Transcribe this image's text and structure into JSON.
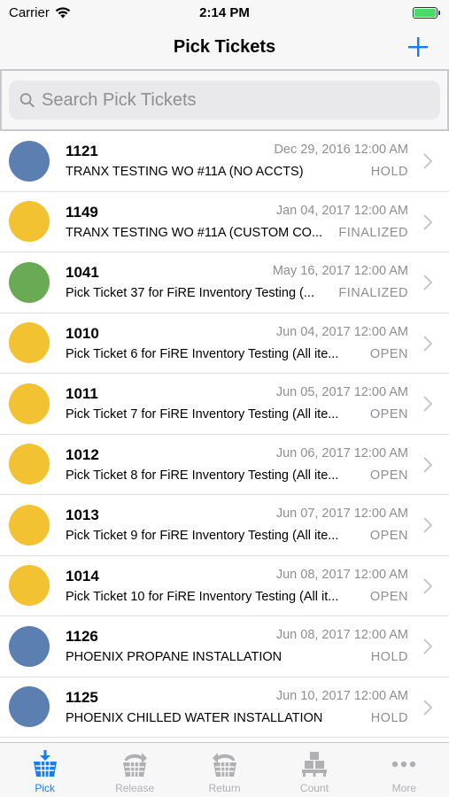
{
  "status_bar": {
    "carrier": "Carrier",
    "time": "2:14 PM"
  },
  "nav": {
    "title": "Pick Tickets"
  },
  "search": {
    "placeholder": "Search Pick Tickets"
  },
  "colors": {
    "accent": "#1a7cf3",
    "hold": "#5b7fb0",
    "open": "#f2c232",
    "finalized_green": "#6aaa55"
  },
  "tickets": [
    {
      "id": "1121",
      "date": "Dec 29, 2016 12:00 AM",
      "description": "TRANX TESTING WO #11A (NO ACCTS)",
      "status": "HOLD",
      "color": "#5b7fb0"
    },
    {
      "id": "1149",
      "date": "Jan 04, 2017 12:00 AM",
      "description": "TRANX TESTING WO #11A (CUSTOM CO...",
      "status": "FINALIZED",
      "color": "#f2c232"
    },
    {
      "id": "1041",
      "date": "May 16, 2017 12:00 AM",
      "description": "Pick Ticket 37 for FiRE Inventory Testing (...",
      "status": "FINALIZED",
      "color": "#6aaa55"
    },
    {
      "id": "1010",
      "date": "Jun 04, 2017 12:00 AM",
      "description": "Pick Ticket 6 for FiRE Inventory Testing (All ite...",
      "status": "OPEN",
      "color": "#f2c232"
    },
    {
      "id": "1011",
      "date": "Jun 05, 2017 12:00 AM",
      "description": "Pick Ticket 7 for FiRE Inventory Testing (All ite...",
      "status": "OPEN",
      "color": "#f2c232"
    },
    {
      "id": "1012",
      "date": "Jun 06, 2017 12:00 AM",
      "description": "Pick Ticket 8 for FiRE Inventory Testing (All ite...",
      "status": "OPEN",
      "color": "#f2c232"
    },
    {
      "id": "1013",
      "date": "Jun 07, 2017 12:00 AM",
      "description": "Pick Ticket 9 for FiRE Inventory Testing (All ite...",
      "status": "OPEN",
      "color": "#f2c232"
    },
    {
      "id": "1014",
      "date": "Jun 08, 2017 12:00 AM",
      "description": "Pick Ticket 10 for FiRE Inventory Testing (All it...",
      "status": "OPEN",
      "color": "#f2c232"
    },
    {
      "id": "1126",
      "date": "Jun 08, 2017 12:00 AM",
      "description": "PHOENIX PROPANE INSTALLATION",
      "status": "HOLD",
      "color": "#5b7fb0"
    },
    {
      "id": "1125",
      "date": "Jun 10, 2017 12:00 AM",
      "description": "PHOENIX CHILLED WATER INSTALLATION",
      "status": "HOLD",
      "color": "#5b7fb0"
    }
  ],
  "tabs": [
    {
      "label": "Pick",
      "icon": "pick-basket-icon",
      "active": true
    },
    {
      "label": "Release",
      "icon": "release-basket-icon",
      "active": false
    },
    {
      "label": "Return",
      "icon": "return-basket-icon",
      "active": false
    },
    {
      "label": "Count",
      "icon": "count-boxes-icon",
      "active": false
    },
    {
      "label": "More",
      "icon": "more-dots-icon",
      "active": false
    }
  ]
}
